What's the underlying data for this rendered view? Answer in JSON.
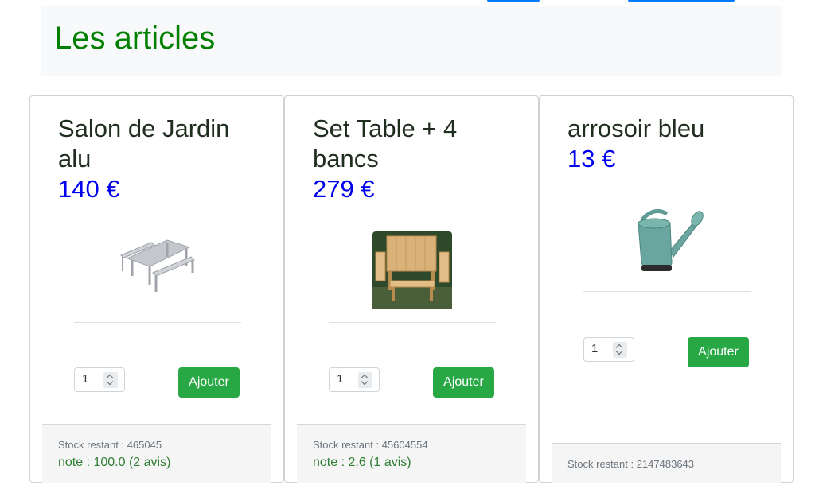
{
  "header": {
    "title": "Les articles"
  },
  "articles": [
    {
      "name": "Salon de Jardin alu",
      "price": "140 €",
      "quantity": "1",
      "add_label": "Ajouter",
      "stock": "Stock restant : 465045",
      "note": "note : 100.0 (2 avis)",
      "image_icon": "garden-table-image"
    },
    {
      "name": "Set Table + 4 bancs",
      "price": "279 €",
      "quantity": "1",
      "add_label": "Ajouter",
      "stock": "Stock restant : 45604554",
      "note": "note : 2.6 (1 avis)",
      "image_icon": "wooden-table-set-image"
    },
    {
      "name": "arrosoir bleu",
      "price": "13 €",
      "quantity": "1",
      "add_label": "Ajouter",
      "stock": "Stock restant : 2147483643",
      "image_icon": "watering-can-image"
    }
  ],
  "colors": {
    "title_green": "#008000",
    "price_blue": "#0000ee",
    "button_green": "#28a745",
    "top_button_blue": "#007bff"
  }
}
